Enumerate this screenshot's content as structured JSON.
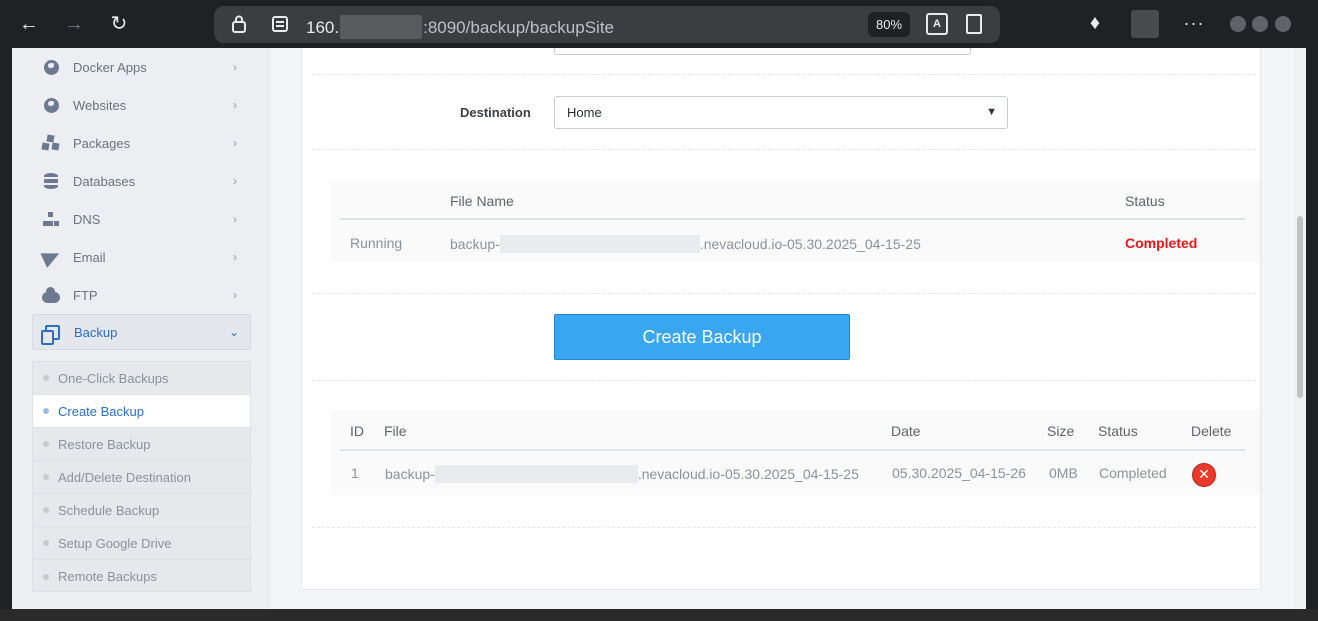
{
  "browser": {
    "url_host": "160.",
    "url_path": ":8090/backup/backupSite",
    "zoom": "80%",
    "translate_icon": "A",
    "more_label": "···"
  },
  "sidebar": {
    "items": [
      {
        "label": "Docker Apps",
        "icon": "globe-icon"
      },
      {
        "label": "Websites",
        "icon": "globe-icon"
      },
      {
        "label": "Packages",
        "icon": "boxes-icon"
      },
      {
        "label": "Databases",
        "icon": "database-icon"
      },
      {
        "label": "DNS",
        "icon": "network-icon"
      },
      {
        "label": "Email",
        "icon": "paper-plane-icon"
      },
      {
        "label": "FTP",
        "icon": "cloud-upload-icon"
      },
      {
        "label": "Backup",
        "icon": "copy-icon"
      }
    ],
    "backup_submenu": [
      "One-Click Backups",
      "Create Backup",
      "Restore Backup",
      "Add/Delete Destination",
      "Schedule Backup",
      "Setup Google Drive",
      "Remote Backups"
    ]
  },
  "form": {
    "destination_label": "Destination",
    "destination_value": "Home"
  },
  "running_table": {
    "headers": [
      "File Name",
      "Status"
    ],
    "row": {
      "state": "Running",
      "file_prefix": "backup-",
      "file_suffix": ".nevacloud.io-05.30.2025_04-15-25",
      "status": "Completed"
    }
  },
  "create_button": "Create Backup",
  "backups_table": {
    "headers": [
      "ID",
      "File",
      "Date",
      "Size",
      "Status",
      "Delete"
    ],
    "rows": [
      {
        "id": "1",
        "file_prefix": "backup-",
        "file_suffix": ".nevacloud.io-05.30.2025_04-15-25",
        "date": "05.30.2025_04-15-26",
        "size": "0MB",
        "status": "Completed"
      }
    ]
  },
  "colors": {
    "accent": "#2e6ec4",
    "button": "#38a6f1",
    "status_red": "#e61919",
    "delete_red": "#e8392b"
  }
}
